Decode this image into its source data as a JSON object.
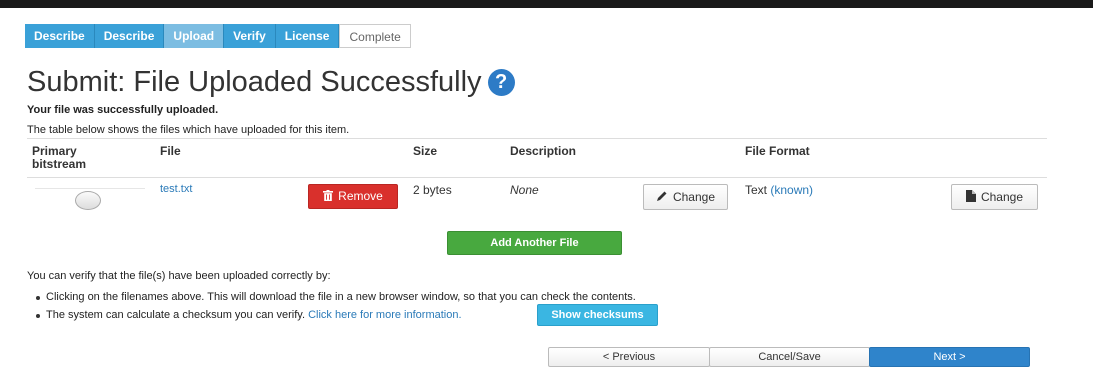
{
  "steps": [
    {
      "label": "Describe",
      "state": "done"
    },
    {
      "label": "Describe",
      "state": "done"
    },
    {
      "label": "Upload",
      "state": "active"
    },
    {
      "label": "Verify",
      "state": "done"
    },
    {
      "label": "License",
      "state": "done"
    },
    {
      "label": "Complete",
      "state": "todo"
    }
  ],
  "page": {
    "title": "Submit: File Uploaded Successfully",
    "help_glyph": "?",
    "success_msg": "Your file was successfully uploaded.",
    "intro": "The table below shows the files which have uploaded for this item."
  },
  "table": {
    "headers": {
      "primary_line1": "Primary",
      "primary_line2": "bitstream",
      "file": "File",
      "size": "Size",
      "description": "Description",
      "format": "File Format"
    },
    "rows": [
      {
        "file": "test.txt",
        "remove_label": "Remove",
        "size": "2 bytes",
        "description": "None",
        "change_desc_label": "Change",
        "format_text": "Text",
        "format_support": "(known)",
        "change_format_label": "Change"
      }
    ]
  },
  "add_another_label": "Add Another File",
  "verify": {
    "intro": "You can verify that the file(s) have been uploaded correctly by:",
    "bullet1": "Clicking on the filenames above. This will download the file in a new browser window, so that you can check the contents.",
    "bullet2": "The system can calculate a checksum you can verify.",
    "bullet2_link": "Click here for more information.",
    "checksums_label": "Show checksums"
  },
  "nav": {
    "previous": "< Previous",
    "cancel": "Cancel/Save",
    "next": "Next >"
  },
  "colors": {
    "step_blue": "#3aa1d8",
    "danger": "#d9302c",
    "success": "#48a93f",
    "info": "#3ab6e2",
    "primary": "#2f84cb"
  }
}
